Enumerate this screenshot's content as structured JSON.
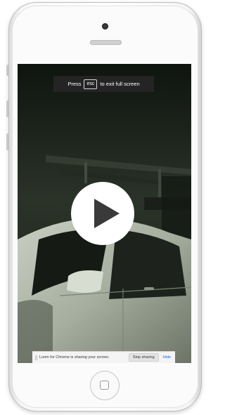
{
  "fullscreen_notice": {
    "prefix": "Press",
    "key": "esc",
    "suffix": "to exit full screen"
  },
  "video": {
    "play_icon": "play-icon"
  },
  "share_bar": {
    "message": "Loom for Chrome is sharing your screen.",
    "stop_label": "Stop sharing",
    "hide_label": "Hide"
  },
  "colors": {
    "link": "#1a66d2",
    "video_bg": "#151a15"
  }
}
